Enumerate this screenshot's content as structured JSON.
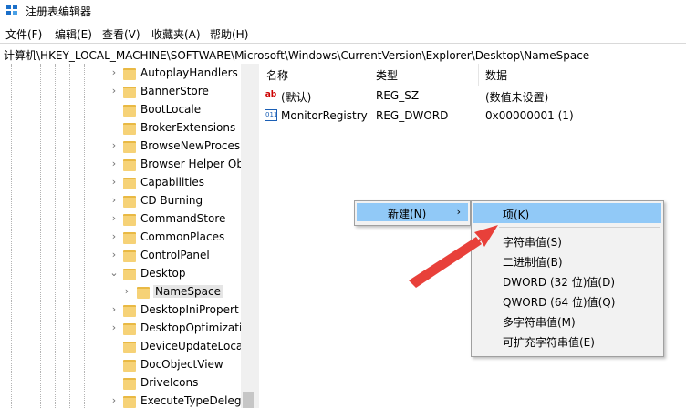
{
  "window": {
    "title": "注册表编辑器"
  },
  "menu": [
    "文件(F)",
    "编辑(E)",
    "查看(V)",
    "收藏夹(A)",
    "帮助(H)"
  ],
  "address": "计算机\\HKEY_LOCAL_MACHINE\\SOFTWARE\\Microsoft\\Windows\\CurrentVersion\\Explorer\\Desktop\\NameSpace",
  "tree": {
    "items": [
      "AutoplayHandlers",
      "BannerStore",
      "BootLocale",
      "BrokerExtensions",
      "BrowseNewProces",
      "Browser Helper Ob",
      "Capabilities",
      "CD Burning",
      "CommandStore",
      "CommonPlaces",
      "ControlPanel",
      "Desktop",
      "NameSpace",
      "DesktopIniPropert",
      "DesktopOptimizati",
      "DeviceUpdateLoca",
      "DocObjectView",
      "DriveIcons",
      "ExecuteTypeDelega"
    ]
  },
  "list": {
    "columns": [
      "名称",
      "类型",
      "数据"
    ],
    "rows": [
      {
        "name": "(默认)",
        "type": "REG_SZ",
        "data": "(数值未设置)",
        "icon": "string-value-icon"
      },
      {
        "name": "MonitorRegistry",
        "type": "REG_DWORD",
        "data": "0x00000001 (1)",
        "icon": "binary-value-icon"
      }
    ]
  },
  "context_menu": {
    "new_label": "新建(N)",
    "submenu": [
      "项(K)",
      "字符串值(S)",
      "二进制值(B)",
      "DWORD (32 位)值(D)",
      "QWORD (64 位)值(Q)",
      "多字符串值(M)",
      "可扩充字符串值(E)"
    ]
  },
  "colors": {
    "highlight": "#91c9f7",
    "arrow": "#e8403a",
    "folder": "#f6d277"
  }
}
